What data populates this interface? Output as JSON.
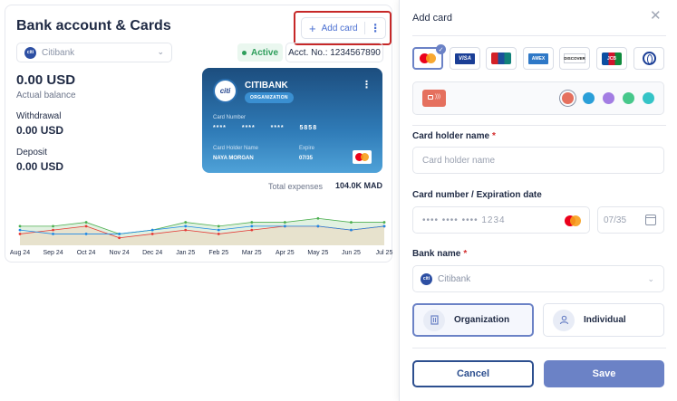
{
  "bank_panel": {
    "title": "Bank account & Cards",
    "add_card_label": "Add card",
    "add_card_icon": "plus-icon",
    "more_icon": "more-vertical-icon",
    "selected_bank": "Citibank",
    "bank_logo_text": "citi",
    "status": "Active",
    "account_number": "Acct. No.: 1234567890",
    "balance": {
      "amount": "0.00 USD",
      "label": "Actual balance"
    },
    "withdrawal": {
      "label": "Withdrawal",
      "amount": "0.00 USD"
    },
    "deposit": {
      "label": "Deposit",
      "amount": "0.00 USD"
    },
    "card": {
      "logo_text": "citi",
      "bank_name": "CITIBANK",
      "tag": "ORGANIZATION",
      "number_label": "Card Number",
      "number": "**** **** **** 5858",
      "holder_label": "Card Holder Name",
      "holder": "NAYA MORGAN",
      "expire_label": "Expire",
      "expire": "07/35",
      "brand": "mastercard"
    },
    "total_expenses_label": "Total expenses",
    "total_expenses_value": "104.0K MAD",
    "colors": {
      "accent": "#4a6fd1",
      "active": "#2e9e5b",
      "card_top": "#1c4d7e",
      "card_bottom": "#4fa2d8"
    }
  },
  "chart_data": {
    "type": "line",
    "categories": [
      "Aug 24",
      "Sep 24",
      "Oct 24",
      "Nov 24",
      "Dec 24",
      "Jan 25",
      "Feb 25",
      "Mar 25",
      "Apr 25",
      "May 25",
      "Jun 25",
      "Jul 25"
    ],
    "series": [
      {
        "values": [
          4,
          4,
          5,
          2,
          3,
          5,
          4,
          5,
          5,
          6,
          5,
          5
        ],
        "color": "#4caf50"
      },
      {
        "values": [
          2,
          3,
          4,
          1,
          2,
          3,
          2,
          3,
          4,
          4,
          3,
          4
        ],
        "color": "#e53935"
      },
      {
        "values": [
          3,
          2,
          2,
          2,
          3,
          4,
          3,
          4,
          4,
          4,
          3,
          4
        ],
        "color": "#1e88e5"
      }
    ],
    "xlabel": "",
    "ylabel": "",
    "grid": false
  },
  "modal": {
    "title": "Add card",
    "close_icon": "close-icon",
    "card_brands": [
      {
        "name": "mastercard",
        "label": ""
      },
      {
        "name": "visa",
        "label": "VISA"
      },
      {
        "name": "unionpay",
        "label": ""
      },
      {
        "name": "amex",
        "label": "AMEX"
      },
      {
        "name": "discover",
        "label": "DISCOVER"
      },
      {
        "name": "jcb",
        "label": "JCB"
      },
      {
        "name": "diners",
        "label": ""
      }
    ],
    "selected_brand": "mastercard",
    "card_colors": [
      "#e5705e",
      "#2a9fd8",
      "#a37de3",
      "#47c88b",
      "#35c4c7"
    ],
    "selected_color": "#e5705e",
    "holder_label": "Card holder name",
    "holder_placeholder": "Card holder name",
    "number_label": "Card number / Expiration date",
    "number_placeholder": "•••• •••• •••• 1234",
    "expiry_placeholder": "07/35",
    "bank_label": "Bank name",
    "bank_value": "Citibank",
    "bank_logo_text": "citi",
    "required_mark": "*",
    "types": [
      {
        "name": "organization",
        "label": "Organization",
        "icon": "building-icon",
        "selected": true
      },
      {
        "name": "individual",
        "label": "Individual",
        "icon": "user-icon",
        "selected": false
      }
    ],
    "cancel_label": "Cancel",
    "save_label": "Save",
    "colors": {
      "primary": "#6b82c6",
      "secondary": "#2d4f8f",
      "required": "#d32f2f"
    }
  }
}
